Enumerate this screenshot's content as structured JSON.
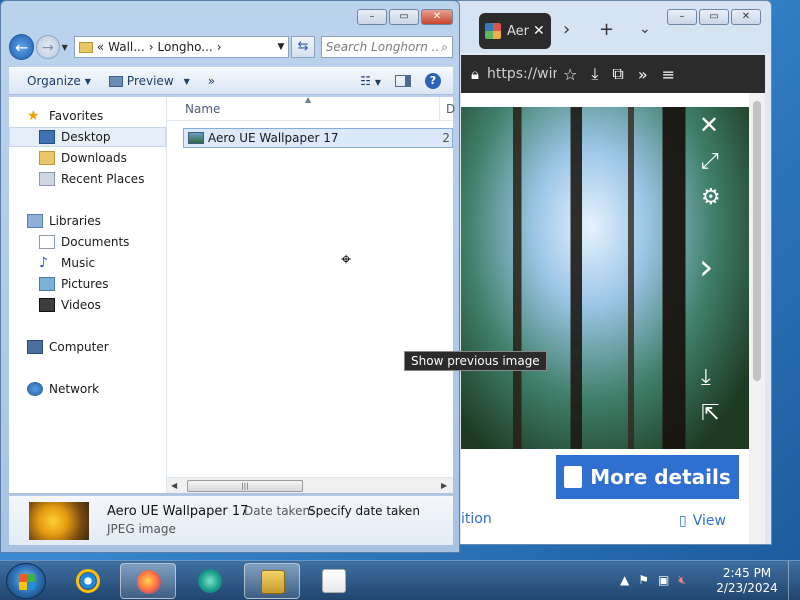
{
  "browser": {
    "tab_title": "Aero",
    "url": "https://windc",
    "more_details_label": "More details",
    "footer_left_text": "ition",
    "footer_right_text": "View",
    "photo_controls": [
      "close-icon",
      "expand-icon",
      "gear-icon",
      "next-icon",
      "download-icon",
      "share-icon"
    ]
  },
  "explorer": {
    "address": [
      "«",
      "Wall...",
      "›",
      "Longho...",
      "›"
    ],
    "search_placeholder": "Search Longhorn ...",
    "toolbar": {
      "organize": "Organize",
      "preview": "Preview",
      "more": "»"
    },
    "nav": {
      "favorites": "Favorites",
      "desktop": "Desktop",
      "downloads": "Downloads",
      "recent_places": "Recent Places",
      "libraries": "Libraries",
      "documents": "Documents",
      "music": "Music",
      "pictures": "Pictures",
      "videos": "Videos",
      "computer": "Computer",
      "network": "Network"
    },
    "columns": {
      "name": "Name",
      "date_abbrev": "D"
    },
    "files": [
      {
        "name": "Aero UE Wallpaper 17",
        "date_abbrev": "2"
      }
    ],
    "details": {
      "name": "Aero UE Wallpaper 17",
      "type": "JPEG image",
      "date_label": "Date taken:",
      "date_value": "Specify date taken"
    }
  },
  "tooltip": "Show previous image",
  "taskbar": {
    "time": "2:45 PM",
    "date": "2/23/2024"
  }
}
